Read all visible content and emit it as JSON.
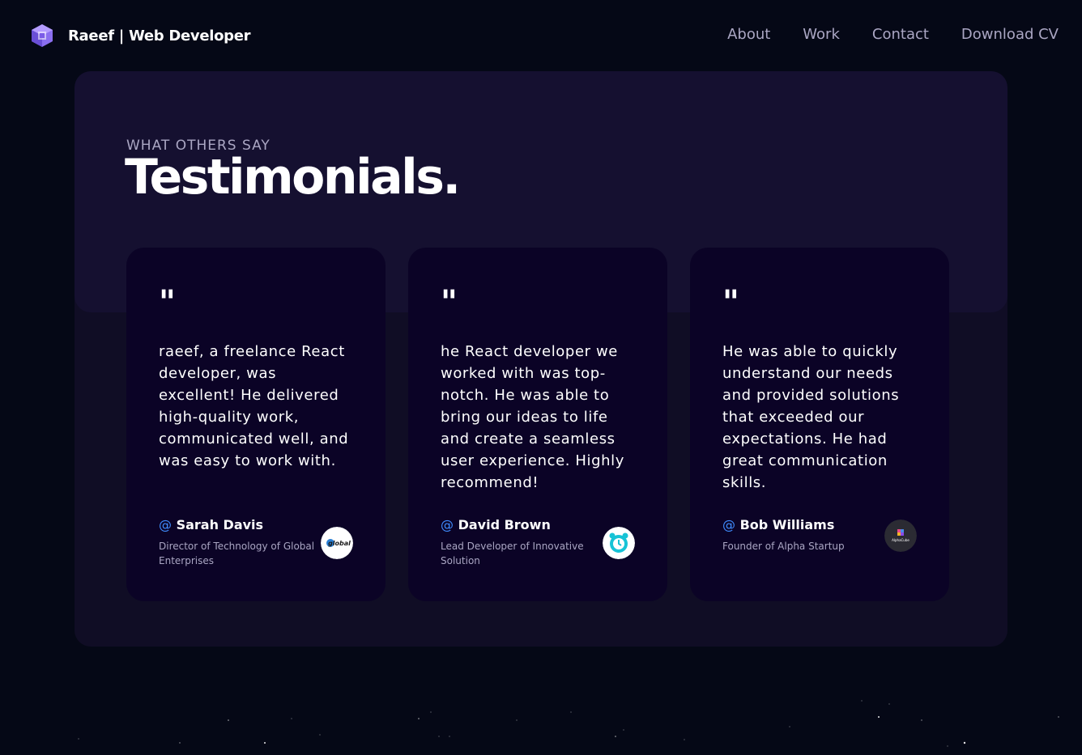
{
  "nav": {
    "brand": "Raeef | Web Developer",
    "links": [
      "About",
      "Work",
      "Contact",
      "Download CV"
    ]
  },
  "section": {
    "subtitle": "WHAT OTHERS SAY",
    "title": "Testimonials."
  },
  "testimonials": [
    {
      "quote_mark": "\"",
      "text": "raeef, a freelance React developer, was excellent! He delivered high-quality work, communicated well, and was easy to work with.",
      "at": "@",
      "name": "Sarah Davis",
      "role": "Director of Technology of Global Enterprises",
      "avatar_icon": "global-logo-icon",
      "avatar_text": "global"
    },
    {
      "quote_mark": "\"",
      "text": "he React developer we worked with was top-notch. He was able to bring our ideas to life and create a seamless user experience. Highly recommend!",
      "at": "@",
      "name": "David Brown",
      "role": "Lead Developer of Innovative Solution",
      "avatar_icon": "alarm-clock-logo-icon"
    },
    {
      "quote_mark": "\"",
      "text": "He was able to quickly understand our needs and provided solutions that exceeded our expectations. He had great communication skills.",
      "at": "@",
      "name": "Bob Williams",
      "role": "Founder of Alpha Startup",
      "avatar_icon": "alpha-startup-logo-icon",
      "avatar_text": "AlphaCube"
    }
  ],
  "colors": {
    "background": "#050816",
    "section": "#100d25",
    "section_top": "#151030",
    "card": "#0b0326",
    "secondary_text": "#aaa6c3",
    "accent_blue": "#3f8cff"
  }
}
